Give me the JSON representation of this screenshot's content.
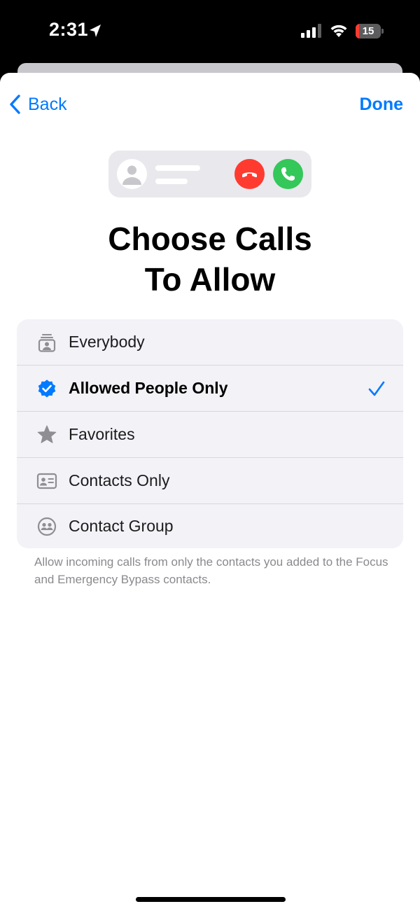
{
  "status_bar": {
    "time": "2:31",
    "battery_level": "15",
    "battery_fraction": 0.15
  },
  "nav": {
    "back_label": "Back",
    "done_label": "Done"
  },
  "title_line1": "Choose Calls",
  "title_line2": "To Allow",
  "options": [
    {
      "label": "Everybody",
      "icon": "people-stack-icon",
      "selected": false
    },
    {
      "label": "Allowed People Only",
      "icon": "verified-badge-icon",
      "selected": true
    },
    {
      "label": "Favorites",
      "icon": "star-icon",
      "selected": false
    },
    {
      "label": "Contacts Only",
      "icon": "contact-card-icon",
      "selected": false
    },
    {
      "label": "Contact Group",
      "icon": "group-icon",
      "selected": false
    }
  ],
  "footnote": "Allow incoming calls from only the contacts you added to the Focus and Emergency Bypass contacts.",
  "colors": {
    "accent": "#007aff",
    "decline": "#ff3b30",
    "accept": "#34c759",
    "list_background": "#f2f2f7"
  }
}
